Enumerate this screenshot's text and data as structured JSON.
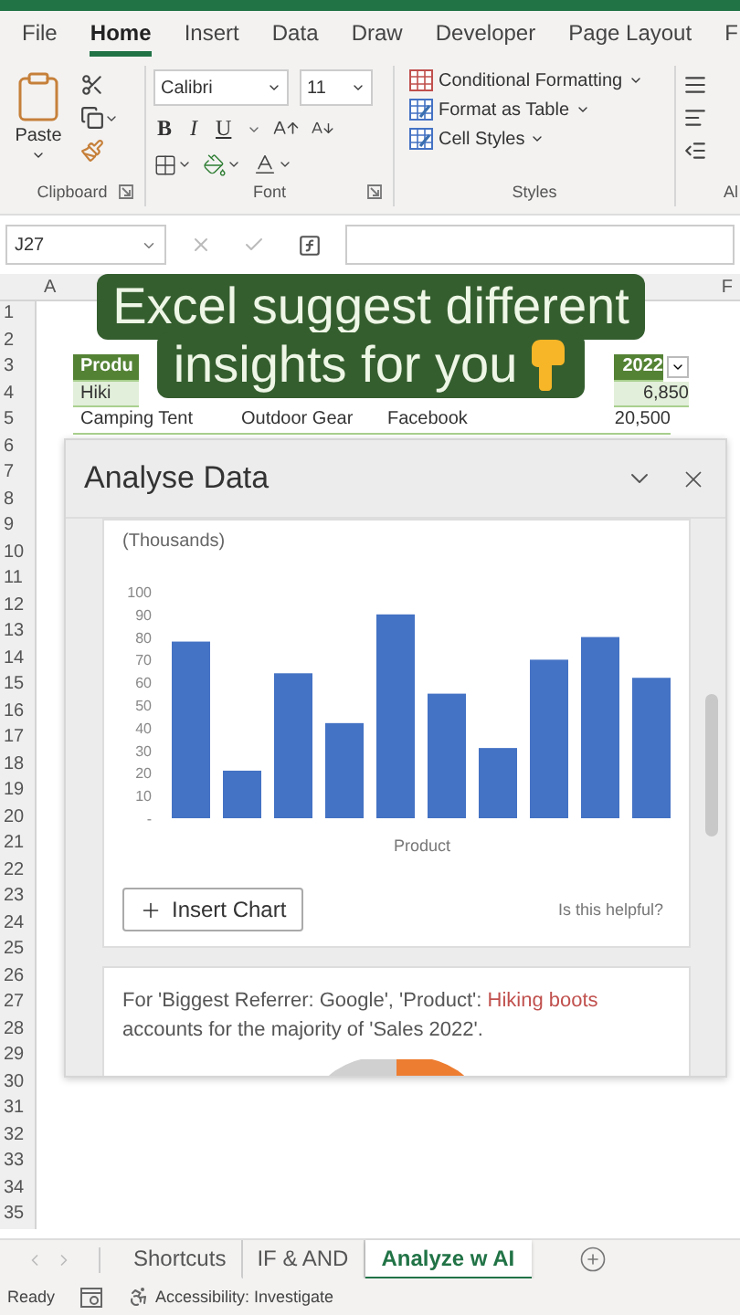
{
  "tabs": [
    {
      "label": "File",
      "selected": false
    },
    {
      "label": "Home",
      "selected": true
    },
    {
      "label": "Insert",
      "selected": false
    },
    {
      "label": "Data",
      "selected": false
    },
    {
      "label": "Draw",
      "selected": false
    },
    {
      "label": "Developer",
      "selected": false
    },
    {
      "label": "Page Layout",
      "selected": false
    },
    {
      "label": "F",
      "selected": false
    }
  ],
  "ribbon": {
    "groups": [
      {
        "kind": "clipboard",
        "label": "Clipboard",
        "paste_label": "Paste",
        "launcher": true
      },
      {
        "kind": "font",
        "label": "Font",
        "font_name": "Calibri",
        "font_size": "11",
        "format_buttons": [
          "B",
          "I",
          "U"
        ],
        "launcher": true
      },
      {
        "kind": "styles",
        "label": "Styles",
        "commands": [
          "Conditional Formatting",
          "Format as Table",
          "Cell Styles"
        ],
        "launcher": false
      },
      {
        "kind": "alignment",
        "label": "Al",
        "launcher": false
      }
    ]
  },
  "name_box": "J27",
  "column_headers": [
    "A",
    "F"
  ],
  "rows": [
    {
      "number": "1"
    },
    {
      "number": "2"
    },
    {
      "number": "3",
      "kind": "header",
      "cells": [
        "Produ",
        "2022"
      ]
    },
    {
      "number": "4",
      "kind": "band",
      "cells": [
        "Hiki",
        "6,850"
      ]
    },
    {
      "number": "5",
      "kind": "plain",
      "cells": [
        "Camping Tent",
        "Outdoor Gear",
        "Facebook",
        "20,500"
      ]
    },
    {
      "number": "6"
    },
    {
      "number": "7"
    },
    {
      "number": "8"
    },
    {
      "number": "9"
    },
    {
      "number": "10"
    },
    {
      "number": "11"
    },
    {
      "number": "12"
    },
    {
      "number": "13"
    },
    {
      "number": "14"
    },
    {
      "number": "15"
    },
    {
      "number": "16"
    },
    {
      "number": "17"
    },
    {
      "number": "18"
    },
    {
      "number": "19"
    },
    {
      "number": "20"
    },
    {
      "number": "21"
    },
    {
      "number": "22"
    },
    {
      "number": "23"
    },
    {
      "number": "24"
    },
    {
      "number": "25"
    },
    {
      "number": "26"
    },
    {
      "number": "27"
    },
    {
      "number": "28"
    },
    {
      "number": "29"
    },
    {
      "number": "30"
    },
    {
      "number": "31"
    },
    {
      "number": "32"
    },
    {
      "number": "33"
    },
    {
      "number": "34"
    },
    {
      "number": "35"
    }
  ],
  "caption": {
    "lines": [
      "Excel suggest different",
      "insights for you"
    ]
  },
  "pane": {
    "title": "Analyse Data",
    "cards": [
      {
        "kind": "chart",
        "chart_data": {
          "type": "bar",
          "ylabel": "(Thousands)",
          "xlabel": "Product",
          "categories": [
            null,
            null,
            null,
            null,
            null,
            null,
            null,
            null,
            null,
            null
          ],
          "ylim": [
            0,
            100
          ],
          "yticks": [
            {
              "value": 0,
              "label": "-"
            },
            {
              "value": 10,
              "label": "10"
            },
            {
              "value": 20,
              "label": "20"
            },
            {
              "value": 30,
              "label": "30"
            },
            {
              "value": 40,
              "label": "40"
            },
            {
              "value": 50,
              "label": "50"
            },
            {
              "value": 60,
              "label": "60"
            },
            {
              "value": 70,
              "label": "70"
            },
            {
              "value": 80,
              "label": "80"
            },
            {
              "value": 90,
              "label": "90"
            },
            {
              "value": 100,
              "label": "100"
            }
          ],
          "series": [
            {
              "color": "#4472c4",
              "values": [
                78,
                21,
                64,
                42,
                90,
                55,
                31,
                70,
                80,
                62
              ]
            }
          ]
        },
        "button": "Insert Chart",
        "feedback": "Is this helpful?"
      },
      {
        "kind": "insight",
        "text_before": "For 'Biggest Referrer: Google', 'Product': ",
        "highlight": "Hiking boots",
        "text_after": " accounts for the majority of 'Sales 2022'."
      }
    ]
  },
  "sheet_tabs": [
    {
      "label": "Shortcuts",
      "selected": false
    },
    {
      "label": "IF & AND",
      "selected": false
    },
    {
      "label": "Analyze w AI",
      "selected": true
    }
  ],
  "status_bar": {
    "mode": "Ready",
    "accessibility": "Accessibility: Investigate"
  }
}
